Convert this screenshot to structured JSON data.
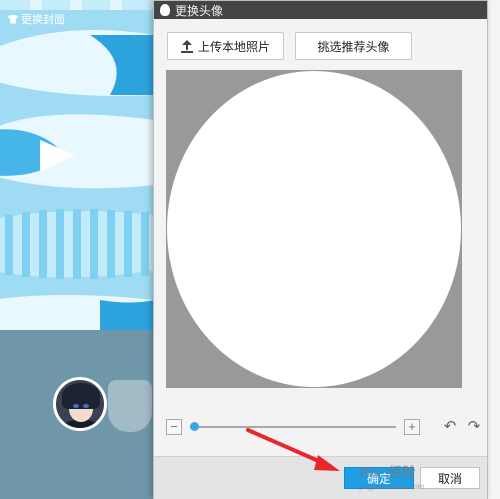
{
  "background": {
    "change_cover_label": "更换封面"
  },
  "dialog": {
    "title": "更换头像",
    "upload_button": "上传本地照片",
    "pick_button": "挑选推荐头像",
    "zoom_out_symbol": "−",
    "zoom_in_symbol": "+",
    "zoom_level": 0,
    "rotate_left_icon": "rotate-left-icon",
    "rotate_right_icon": "rotate-right-icon",
    "ok_button": "确定",
    "cancel_button": "取消"
  },
  "watermark": {
    "text": "Bai 经验",
    "sub": "jingyan.baidu.com"
  },
  "colors": {
    "accent": "#1f9ee8",
    "slider_knob": "#39a7e6",
    "crop_bg": "#999999",
    "titlebar": "#444444"
  }
}
